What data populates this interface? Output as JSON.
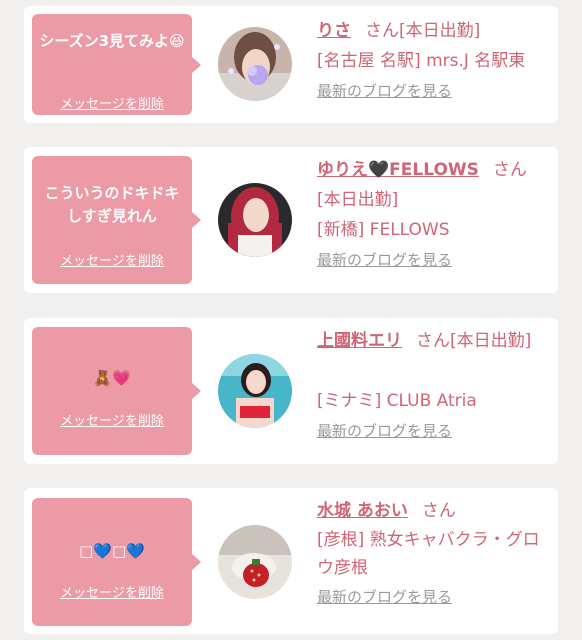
{
  "cards": [
    {
      "message": "シーズン3見てみよ😆",
      "delete_label": "メッセージを削除",
      "name": "りさ",
      "honorific": "さん",
      "status": "[本日出勤]",
      "shop": "[名古屋 名駅] mrs.J 名駅東",
      "blog_label": "最新のブログを見る"
    },
    {
      "message": "こういうのドキドキしすぎ見れん",
      "delete_label": "メッセージを削除",
      "name": "ゆりえ🖤FELLOWS",
      "honorific": "さん",
      "status": "[本日出勤]",
      "shop": "[新橋] FELLOWS",
      "blog_label": "最新のブログを見る"
    },
    {
      "message": "🧸💗",
      "delete_label": "メッセージを削除",
      "name": "上國料エリ",
      "honorific": "さん",
      "status": "[本日出勤]",
      "shop": "[ミナミ] CLUB Atria",
      "blog_label": "最新のブログを見る"
    },
    {
      "message": "□💙□💙",
      "delete_label": "メッセージを削除",
      "name": "水城 あおい",
      "honorific": "さん",
      "status": "",
      "shop": "[彦根] 熟女キャバクラ・グロウ彦根",
      "blog_label": "最新のブログを見る"
    }
  ],
  "colors": {
    "accent": "#d06577",
    "bubble": "#ec9aa6",
    "link_gray": "#9a9a9a",
    "background": "#f1f0ef"
  }
}
